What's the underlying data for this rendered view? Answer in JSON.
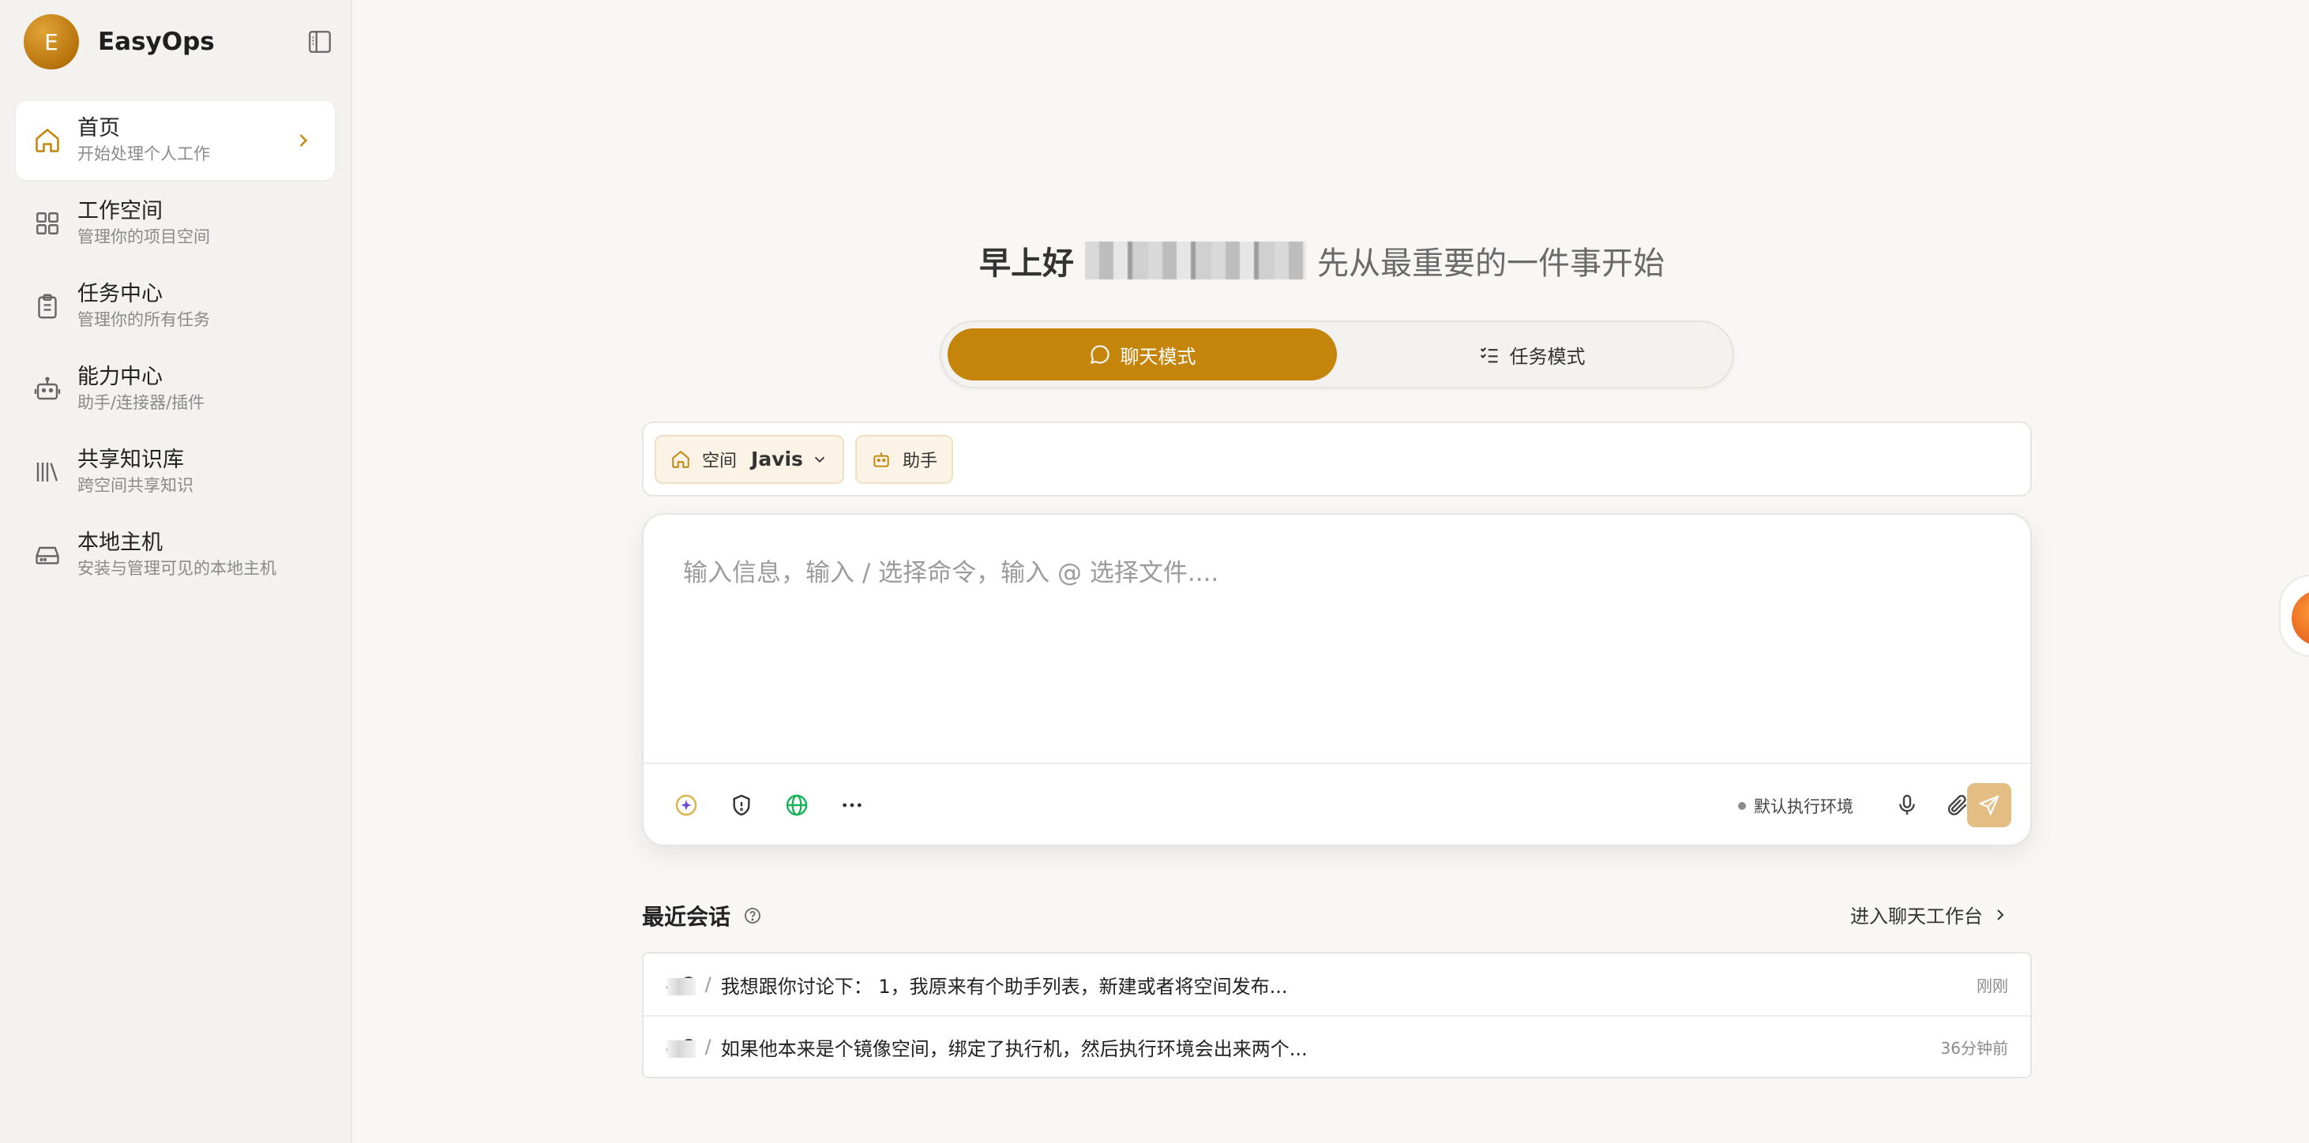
{
  "app": {
    "brand_initial": "E",
    "brand_name": "EasyOps",
    "accent_color": "#c4850a"
  },
  "sidebar": {
    "collapse_icon": "sidebar-collapse-icon",
    "items": [
      {
        "title": "首页",
        "subtitle": "开始处理个人工作",
        "icon": "home-icon",
        "active": true
      },
      {
        "title": "工作空间",
        "subtitle": "管理你的项目空间",
        "icon": "grid-icon",
        "active": false
      },
      {
        "title": "任务中心",
        "subtitle": "管理你的所有任务",
        "icon": "clipboard-icon",
        "active": false
      },
      {
        "title": "能力中心",
        "subtitle": "助手/连接器/插件",
        "icon": "robot-icon",
        "active": false
      },
      {
        "title": "共享知识库",
        "subtitle": "跨空间共享知识",
        "icon": "library-icon",
        "active": false
      },
      {
        "title": "本地主机",
        "subtitle": "安装与管理可见的本地主机",
        "icon": "hard-drive-icon",
        "active": false
      }
    ]
  },
  "greeting": {
    "prefix": "早上好",
    "suffix": "先从最重要的一件事开始"
  },
  "modes": {
    "chat": "聊天模式",
    "task": "任务模式",
    "active": "chat"
  },
  "context_bar": {
    "space_label": "空间",
    "space_value": "Javis",
    "assistant_label": "助手"
  },
  "composer": {
    "placeholder": "输入信息，输入 / 选择命令，输入 @ 选择文件....",
    "env_label": "默认执行环境"
  },
  "recent": {
    "title": "最近会话",
    "link": "进入聊天工作台",
    "conversations": [
      {
        "space": "a                        2",
        "text": "我想跟你讨论下： 1，我原来有个助手列表，新建或者将空间发布...",
        "time": "刚刚"
      },
      {
        "space": "a                        3",
        "text": "如果他本来是个镜像空间，绑定了执行机，然后执行环境会出来两个...",
        "time": "36分钟前"
      }
    ]
  }
}
